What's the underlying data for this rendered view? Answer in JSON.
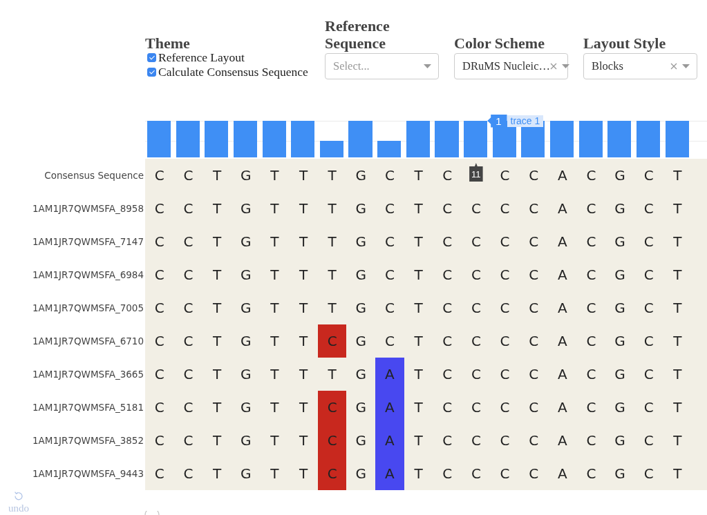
{
  "theme": {
    "heading": "Theme",
    "options": [
      {
        "label": "Reference Layout",
        "checked": true
      },
      {
        "label": "Calculate Consensus Sequence",
        "checked": true
      }
    ]
  },
  "dropdowns": [
    {
      "heading": "Reference Sequence",
      "placeholder": "Select..."
    },
    {
      "heading": "Color Scheme",
      "value": "DRuMS Nucleic…"
    },
    {
      "heading": "Layout Style",
      "value": "Blocks"
    }
  ],
  "conservation_bars": [
    {
      "level": 1
    },
    {
      "level": 1
    },
    {
      "level": 1
    },
    {
      "level": 1
    },
    {
      "level": 1
    },
    {
      "level": 1
    },
    {
      "level": 0.45
    },
    {
      "level": 1
    },
    {
      "level": 0.45
    },
    {
      "level": 1
    },
    {
      "level": 1
    },
    {
      "level": 1,
      "hover": {
        "value": "1",
        "trace": "trace 1"
      }
    },
    {
      "level": 1
    },
    {
      "level": 1
    },
    {
      "level": 1
    },
    {
      "level": 1
    },
    {
      "level": 1
    },
    {
      "level": 1
    },
    {
      "level": 1
    }
  ],
  "alignment": {
    "rows": [
      {
        "name": "Consensus Sequence",
        "cells": [
          {
            "base": "C"
          },
          {
            "base": "C"
          },
          {
            "base": "T"
          },
          {
            "base": "G"
          },
          {
            "base": "T"
          },
          {
            "base": "T"
          },
          {
            "base": "T"
          },
          {
            "base": "G"
          },
          {
            "base": "C"
          },
          {
            "base": "T"
          },
          {
            "base": "C"
          },
          {
            "hover_label": "11"
          },
          {
            "base": "C"
          },
          {
            "base": "C"
          },
          {
            "base": "A"
          },
          {
            "base": "C"
          },
          {
            "base": "G"
          },
          {
            "base": "C"
          },
          {
            "base": "T"
          }
        ]
      },
      {
        "name": "1AM1JR7QWMSFA_8958",
        "cells": [
          {
            "base": "C"
          },
          {
            "base": "C"
          },
          {
            "base": "T"
          },
          {
            "base": "G"
          },
          {
            "base": "T"
          },
          {
            "base": "T"
          },
          {
            "base": "T"
          },
          {
            "base": "G"
          },
          {
            "base": "C"
          },
          {
            "base": "T"
          },
          {
            "base": "C"
          },
          {
            "base": "C"
          },
          {
            "base": "C"
          },
          {
            "base": "C"
          },
          {
            "base": "A"
          },
          {
            "base": "C"
          },
          {
            "base": "G"
          },
          {
            "base": "C"
          },
          {
            "base": "T"
          }
        ]
      },
      {
        "name": "1AM1JR7QWMSFA_7147",
        "cells": [
          {
            "base": "C"
          },
          {
            "base": "C"
          },
          {
            "base": "T"
          },
          {
            "base": "G"
          },
          {
            "base": "T"
          },
          {
            "base": "T"
          },
          {
            "base": "T"
          },
          {
            "base": "G"
          },
          {
            "base": "C"
          },
          {
            "base": "T"
          },
          {
            "base": "C"
          },
          {
            "base": "C"
          },
          {
            "base": "C"
          },
          {
            "base": "C"
          },
          {
            "base": "A"
          },
          {
            "base": "C"
          },
          {
            "base": "G"
          },
          {
            "base": "C"
          },
          {
            "base": "T"
          }
        ]
      },
      {
        "name": "1AM1JR7QWMSFA_6984",
        "cells": [
          {
            "base": "C"
          },
          {
            "base": "C"
          },
          {
            "base": "T"
          },
          {
            "base": "G"
          },
          {
            "base": "T"
          },
          {
            "base": "T"
          },
          {
            "base": "T"
          },
          {
            "base": "G"
          },
          {
            "base": "C"
          },
          {
            "base": "T"
          },
          {
            "base": "C"
          },
          {
            "base": "C"
          },
          {
            "base": "C"
          },
          {
            "base": "C"
          },
          {
            "base": "A"
          },
          {
            "base": "C"
          },
          {
            "base": "G"
          },
          {
            "base": "C"
          },
          {
            "base": "T"
          }
        ]
      },
      {
        "name": "1AM1JR7QWMSFA_7005",
        "cells": [
          {
            "base": "C"
          },
          {
            "base": "C"
          },
          {
            "base": "T"
          },
          {
            "base": "G"
          },
          {
            "base": "T"
          },
          {
            "base": "T"
          },
          {
            "base": "T"
          },
          {
            "base": "G"
          },
          {
            "base": "C"
          },
          {
            "base": "T"
          },
          {
            "base": "C"
          },
          {
            "base": "C"
          },
          {
            "base": "C"
          },
          {
            "base": "C"
          },
          {
            "base": "A"
          },
          {
            "base": "C"
          },
          {
            "base": "G"
          },
          {
            "base": "C"
          },
          {
            "base": "T"
          }
        ]
      },
      {
        "name": "1AM1JR7QWMSFA_6710",
        "cells": [
          {
            "base": "C"
          },
          {
            "base": "C"
          },
          {
            "base": "T"
          },
          {
            "base": "G"
          },
          {
            "base": "T"
          },
          {
            "base": "T"
          },
          {
            "base": "C",
            "color": "#c8281e"
          },
          {
            "base": "G"
          },
          {
            "base": "C"
          },
          {
            "base": "T"
          },
          {
            "base": "C"
          },
          {
            "base": "C"
          },
          {
            "base": "C"
          },
          {
            "base": "C"
          },
          {
            "base": "A"
          },
          {
            "base": "C"
          },
          {
            "base": "G"
          },
          {
            "base": "C"
          },
          {
            "base": "T"
          }
        ]
      },
      {
        "name": "1AM1JR7QWMSFA_3665",
        "cells": [
          {
            "base": "C"
          },
          {
            "base": "C"
          },
          {
            "base": "T"
          },
          {
            "base": "G"
          },
          {
            "base": "T"
          },
          {
            "base": "T"
          },
          {
            "base": "T"
          },
          {
            "base": "G"
          },
          {
            "base": "A",
            "color": "#4848f0"
          },
          {
            "base": "T"
          },
          {
            "base": "C"
          },
          {
            "base": "C"
          },
          {
            "base": "C"
          },
          {
            "base": "C"
          },
          {
            "base": "A"
          },
          {
            "base": "C"
          },
          {
            "base": "G"
          },
          {
            "base": "C"
          },
          {
            "base": "T"
          }
        ]
      },
      {
        "name": "1AM1JR7QWMSFA_5181",
        "cells": [
          {
            "base": "C"
          },
          {
            "base": "C"
          },
          {
            "base": "T"
          },
          {
            "base": "G"
          },
          {
            "base": "T"
          },
          {
            "base": "T"
          },
          {
            "base": "C",
            "color": "#c8281e"
          },
          {
            "base": "G"
          },
          {
            "base": "A",
            "color": "#4848f0"
          },
          {
            "base": "T"
          },
          {
            "base": "C"
          },
          {
            "base": "C"
          },
          {
            "base": "C"
          },
          {
            "base": "C"
          },
          {
            "base": "A"
          },
          {
            "base": "C"
          },
          {
            "base": "G"
          },
          {
            "base": "C"
          },
          {
            "base": "T"
          }
        ]
      },
      {
        "name": "1AM1JR7QWMSFA_3852",
        "cells": [
          {
            "base": "C"
          },
          {
            "base": "C"
          },
          {
            "base": "T"
          },
          {
            "base": "G"
          },
          {
            "base": "T"
          },
          {
            "base": "T"
          },
          {
            "base": "C",
            "color": "#c8281e"
          },
          {
            "base": "G"
          },
          {
            "base": "A",
            "color": "#4848f0"
          },
          {
            "base": "T"
          },
          {
            "base": "C"
          },
          {
            "base": "C"
          },
          {
            "base": "C"
          },
          {
            "base": "C"
          },
          {
            "base": "A"
          },
          {
            "base": "C"
          },
          {
            "base": "G"
          },
          {
            "base": "C"
          },
          {
            "base": "T"
          }
        ]
      },
      {
        "name": "1AM1JR7QWMSFA_9443",
        "cells": [
          {
            "base": "C"
          },
          {
            "base": "C"
          },
          {
            "base": "T"
          },
          {
            "base": "G"
          },
          {
            "base": "T"
          },
          {
            "base": "T"
          },
          {
            "base": "C",
            "color": "#c8281e"
          },
          {
            "base": "G"
          },
          {
            "base": "A",
            "color": "#4848f0"
          },
          {
            "base": "T"
          },
          {
            "base": "C"
          },
          {
            "base": "C"
          },
          {
            "base": "C"
          },
          {
            "base": "C"
          },
          {
            "base": "A"
          },
          {
            "base": "C"
          },
          {
            "base": "G"
          },
          {
            "base": "C"
          },
          {
            "base": "T"
          }
        ]
      }
    ]
  },
  "undo": {
    "label": "undo"
  }
}
